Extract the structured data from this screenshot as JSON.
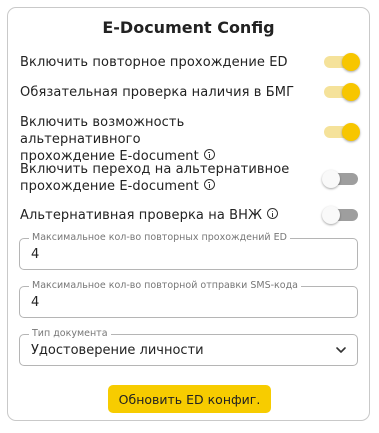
{
  "title": "E-Document Config",
  "toggles": [
    {
      "label_line1": "Включить повторное прохождение ED",
      "label_line2": "",
      "info_icon": false,
      "enabled": true
    },
    {
      "label_line1": "Обязательная проверка наличия в БМГ",
      "label_line2": "",
      "info_icon": false,
      "enabled": true
    },
    {
      "label_line1": "Включить возможность альтернативного",
      "label_line2": "прохождение E-document",
      "info_icon": true,
      "enabled": true
    },
    {
      "label_line1": "Включить переход на альтернативное",
      "label_line2": "прохождение E-document",
      "info_icon": true,
      "enabled": false
    },
    {
      "label_line1": "Альтернативная проверка на ВНЖ",
      "label_line2": "",
      "info_icon": true,
      "enabled": false
    }
  ],
  "fields": {
    "max_repeats": {
      "label": "Максимальное кол-во повторных прохождений ED",
      "value": "4"
    },
    "max_sms": {
      "label": "Максимальное кол-во повторной отправки SMS-кода",
      "value": "4"
    },
    "doc_type": {
      "label": "Тип документа",
      "value": "Удостоверение личности"
    }
  },
  "button": {
    "label": "Обновить ED конфиг."
  },
  "colors": {
    "accent": "#f7cc00",
    "toggle_on_track": "#f5e29a",
    "toggle_on_thumb": "#f7c600",
    "toggle_off_track": "#9e9e9e",
    "toggle_off_thumb": "#f9f9f9"
  },
  "icons": {
    "info": "info-circle-icon",
    "dropdown": "chevron-down-icon"
  }
}
